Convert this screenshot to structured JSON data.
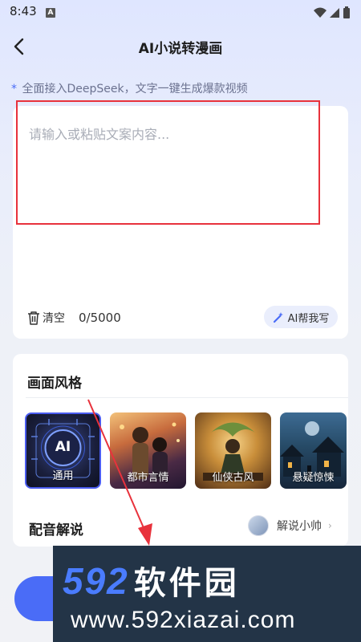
{
  "status_bar": {
    "time": "8:43",
    "notification_icon": "A"
  },
  "header": {
    "title": "AI小说转漫画",
    "back_icon": "chevron-left-icon"
  },
  "notice": {
    "star": "*",
    "text": "全面接入DeepSeek，文字一键生成爆款视频"
  },
  "editor": {
    "placeholder": "请输入或粘贴文案内容...",
    "clear_label": "清空",
    "counter": "0/5000",
    "ai_write_label": "AI帮我写"
  },
  "style_section": {
    "title": "画面风格",
    "selected_index": 0,
    "styles": [
      {
        "label": "通用",
        "badge": "AI"
      },
      {
        "label": "都市言情"
      },
      {
        "label": "仙侠古风"
      },
      {
        "label": "悬疑惊悚"
      }
    ]
  },
  "voice_section": {
    "title": "配音解说",
    "voice_name": "解说小帅"
  },
  "watermark": {
    "logo_number": "592",
    "logo_text": "软件园",
    "url": "www.592xiazai.com"
  },
  "colors": {
    "accent": "#4a6cf7",
    "highlight_border": "#e8323c",
    "annotation_arrow": "#e8323c",
    "watermark_bg": "#233447"
  }
}
